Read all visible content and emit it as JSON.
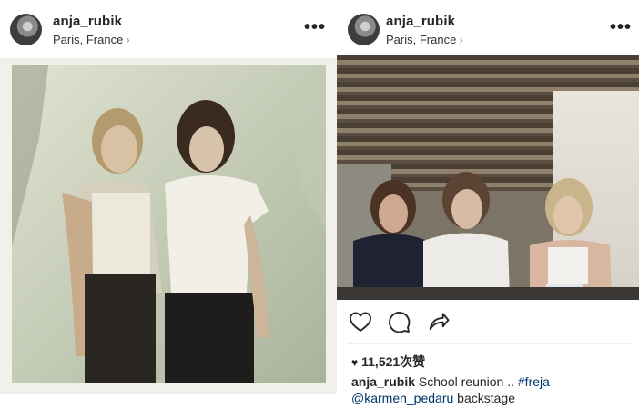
{
  "left_post": {
    "username": "anja_rubik",
    "location": "Paris, France",
    "location_chevron": "›",
    "more": "•••"
  },
  "right_post": {
    "username": "anja_rubik",
    "location": "Paris, France",
    "location_chevron": "›",
    "more": "•••",
    "actions": {
      "like_icon": "heart-outline-icon",
      "comment_icon": "comment-bubble-icon",
      "share_icon": "share-arrow-icon"
    },
    "likes_icon": "♥",
    "likes": "11,521次赞",
    "caption": {
      "username": "anja_rubik",
      "text": "School reunion .. ",
      "hashtag": "#freja",
      "mention": "@karmen_pedaru",
      "text_end": " backstage"
    }
  },
  "colors": {
    "link": "#003569",
    "text": "#262626",
    "muted": "#9a9a9a"
  }
}
